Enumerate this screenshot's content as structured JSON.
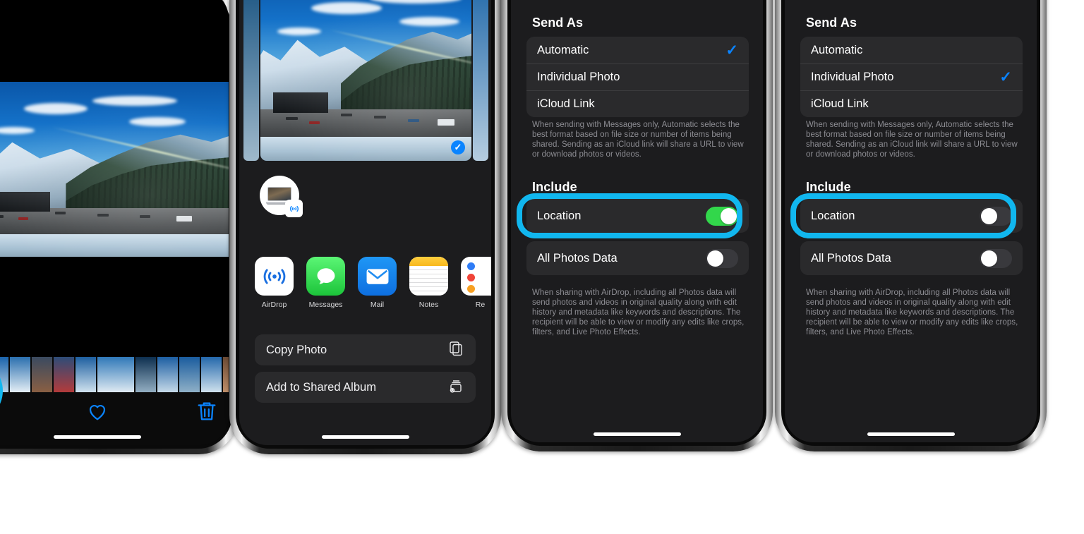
{
  "page": {
    "background": "#ffffff",
    "highlight_color": "#11b7ef"
  },
  "phone1": {
    "name": "Photos viewer",
    "toolbar": {
      "share_icon": "share-up-arrow-icon",
      "favorite_icon": "heart-icon",
      "delete_icon": "trash-icon"
    }
  },
  "phone2": {
    "name": "Share sheet",
    "photo_selected_badge": "✓",
    "airdrop_target": {
      "device_icon": "macbook-icon",
      "badge_icon": "airdrop-icon"
    },
    "apps": [
      {
        "label": "AirDrop",
        "icon": "airdrop-icon"
      },
      {
        "label": "Messages",
        "icon": "messages-icon"
      },
      {
        "label": "Mail",
        "icon": "mail-icon"
      },
      {
        "label": "Notes",
        "icon": "notes-icon"
      },
      {
        "label": "Re",
        "icon": "reminders-icon"
      }
    ],
    "actions": [
      {
        "label": "Copy Photo",
        "icon": "copy-icon"
      },
      {
        "label": "Add to Shared Album",
        "icon": "shared-album-icon"
      }
    ]
  },
  "options_sheet": {
    "send_as": {
      "header": "Send As",
      "options": [
        "Automatic",
        "Individual Photo",
        "iCloud Link"
      ],
      "footnote": "When sending with Messages only, Automatic selects the best format based on file size or number of items being shared. Sending as an iCloud link will share a URL to view or download photos or videos.",
      "check_glyph": "✓"
    },
    "include": {
      "header": "Include",
      "rows": [
        "Location",
        "All Photos Data"
      ],
      "footnote": "When sharing with AirDrop, including all Photos data will send photos and videos in original quality along with edit history and metadata like keywords and descriptions. The recipient will be able to view or modify any edits like crops, filters, and Live Photo Effects."
    }
  },
  "phone3": {
    "name": "Options — Automatic, Location on",
    "selected_send_as": "Automatic",
    "location_on": "on",
    "all_photos_data_on": "off"
  },
  "phone4": {
    "name": "Options — Individual Photo, Location off",
    "selected_send_as": "Individual Photo",
    "location_on": "off",
    "all_photos_data_on": "off"
  },
  "colors": {
    "sheet_bg": "#1c1c1e",
    "group_bg": "#2a2a2c",
    "toggle_on": "#32d74b",
    "toggle_off": "#39393d",
    "accent_blue": "#0a84ff",
    "footnote_grey": "#8d8d93"
  }
}
